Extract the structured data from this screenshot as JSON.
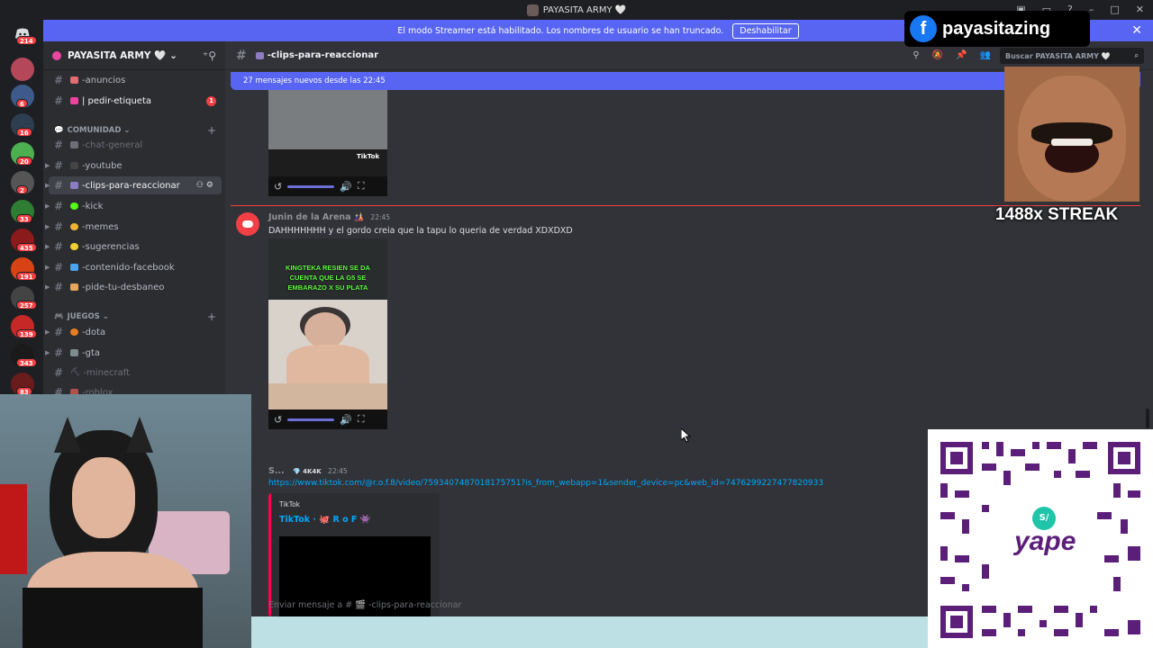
{
  "titlebar": {
    "title": "PAYASITA ARMY 🤍"
  },
  "banner": {
    "text": "El modo Streamer está habilitado. Los nombres de usuario se han truncado.",
    "button": "Deshabilitar"
  },
  "rail_badges": [
    "214",
    "6",
    "16",
    "20",
    "2",
    "33",
    "435",
    "191",
    "257",
    "139",
    "343",
    "83"
  ],
  "guild": {
    "name": "PAYASITA ARMY 🤍"
  },
  "channels_top": [
    {
      "name": "-anuncios"
    },
    {
      "name": "| pedir-etiqueta",
      "unread": "1"
    }
  ],
  "category_comunidad": "COMUNIDAD",
  "channels_comunidad": [
    {
      "name": "-chat-general"
    },
    {
      "name": "-youtube"
    },
    {
      "name": "-clips-para-reaccionar"
    },
    {
      "name": "-kick"
    },
    {
      "name": "-memes"
    },
    {
      "name": "-sugerencias"
    },
    {
      "name": "-contenido-facebook"
    },
    {
      "name": "-pide-tu-desbaneo"
    }
  ],
  "category_juegos": "JUEGOS",
  "channels_juegos": [
    {
      "name": "-dota"
    },
    {
      "name": "-gta"
    },
    {
      "name": "-minecraft"
    },
    {
      "name": "-roblox"
    }
  ],
  "header": {
    "channel": "-clips-para-reaccionar",
    "search_placeholder": "Buscar PAYASITA ARMY 🤍"
  },
  "new_messages": "27 mensajes nuevos desde las 22:45",
  "messages": [
    {
      "author": "Junin de la Arena",
      "time": "22:45",
      "text": "DAHHHHHHH y el gordo creia que la tapu lo queria de verdad XDXDXD",
      "video_caption": "KINGTEKA RESIEN SE DA CUENTA QUE LA G5 SE EMBARAZO X SU PLATA"
    },
    {
      "author": "S...",
      "tag": "4K4K",
      "time": "22:45",
      "link": "https://www.tiktok.com/@r.o.f.8/video/7593407487018175751?is_from_webapp=1&sender_device=pc&web_id=7476299227477820933",
      "embed_provider": "TikTok",
      "embed_title": "TikTok · 🐙 R o F 👾"
    }
  ],
  "first_video_brand": "TikTok",
  "composer_placeholder": "Enviar mensaje a # 🎬 -clips-para-reaccionar",
  "overlays": {
    "facebook_handle": "payasitazing",
    "streak": "1488x STREAK",
    "qr_brand": "yape",
    "qr_badge": "S/"
  }
}
